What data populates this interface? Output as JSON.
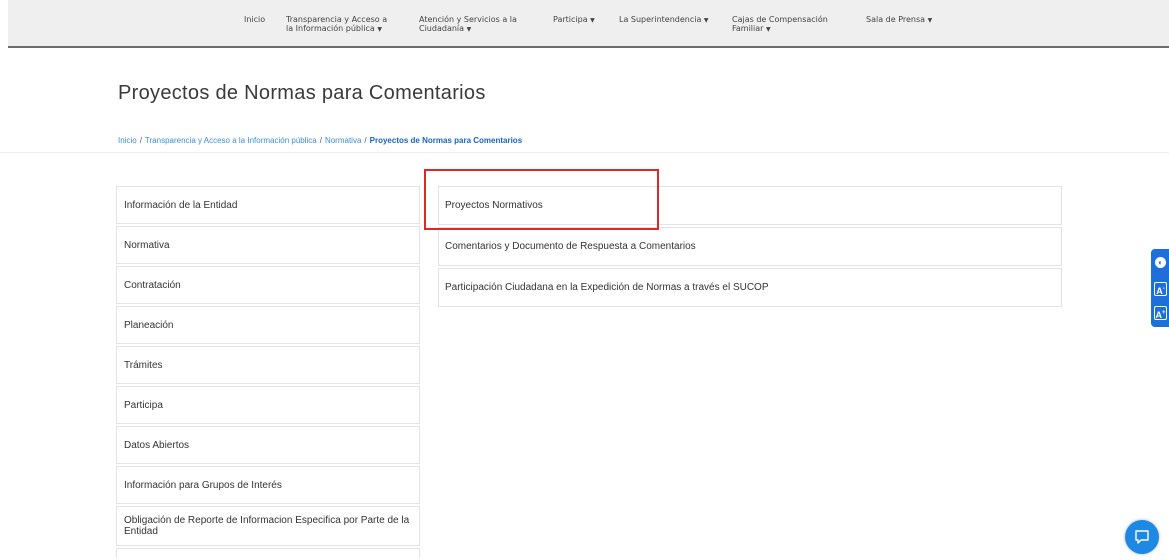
{
  "nav": {
    "items": [
      {
        "label": "Inicio"
      },
      {
        "line1": "Transparencia y Acceso a",
        "line2": "la Información pública"
      },
      {
        "line1": "Atención y Servicios a la",
        "line2": "Ciudadanía"
      },
      {
        "label": "Participa"
      },
      {
        "label": "La Superintendencia"
      },
      {
        "line1": "Cajas de Compensación",
        "line2": "Familiar"
      },
      {
        "label": "Sala de Prensa"
      }
    ],
    "caret_icon": "caret-down-icon"
  },
  "page": {
    "title": "Proyectos de Normas para Comentarios"
  },
  "breadcrumb": {
    "items": [
      "Inicio",
      "Transparencia y Acceso a la Información pública",
      "Normativa"
    ],
    "separator": "/",
    "current": "Proyectos de Normas para Comentarios"
  },
  "left_menu": {
    "items": [
      "Información de la Entidad",
      "Normativa",
      "Contratación",
      "Planeación",
      "Trámites",
      "Participa",
      "Datos Abiertos",
      "Información para Grupos de Interés",
      "Obligación de Reporte de Informacion Especifica por Parte de la Entidad"
    ]
  },
  "right_list": {
    "items": [
      "Proyectos Normativos",
      "Comentarios y Documento de Respuesta a Comentarios",
      "Participación Ciudadana en la Expedición de Normas a través el SUCOP"
    ]
  },
  "accessibility": {
    "contrast_icon": "contrast-icon",
    "decrease_label": "A",
    "increase_label": "A",
    "decrease_mark": "-",
    "increase_mark": "+"
  },
  "chat": {
    "icon": "chat-icon"
  },
  "colors": {
    "accent": "#1e6fd9",
    "link": "#3b8fd9",
    "highlight": "#e0262a"
  }
}
